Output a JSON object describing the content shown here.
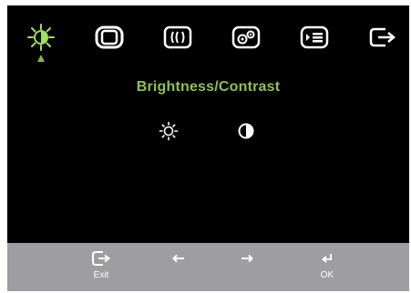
{
  "menu": {
    "title": "Brightness/Contrast",
    "icons": [
      "brightness-icon",
      "image-position-icon",
      "image-setup-icon",
      "image-properties-icon",
      "options-icon",
      "exit-icon"
    ],
    "selected_index": 0,
    "colors": {
      "selected_icon": "#9fe05a",
      "icon": "#ffffff",
      "title": "#8cc152",
      "background": "#000000",
      "bar": "#9e9ea0"
    }
  },
  "submenu": {
    "icons": [
      "brightness-sun-icon",
      "contrast-icon"
    ]
  },
  "controls": {
    "exit_label": "Exit",
    "left_label": "",
    "right_label": "",
    "ok_label": "OK"
  }
}
